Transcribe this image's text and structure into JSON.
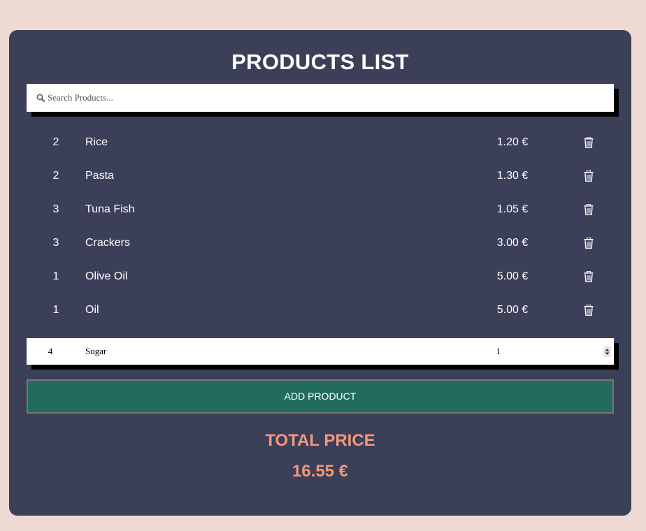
{
  "title": "PRODUCTS LIST",
  "search": {
    "placeholder": "Search Products...",
    "value": "",
    "icon": "search-icon"
  },
  "products": [
    {
      "qty": "2",
      "name": "Rice",
      "price": "1.20 €"
    },
    {
      "qty": "2",
      "name": "Pasta",
      "price": "1.30 €"
    },
    {
      "qty": "3",
      "name": "Tuna Fish",
      "price": "1.05 €"
    },
    {
      "qty": "3",
      "name": "Crackers",
      "price": "3.00 €"
    },
    {
      "qty": "1",
      "name": "Olive Oil",
      "price": "5.00 €"
    },
    {
      "qty": "1",
      "name": "Oil",
      "price": "5.00 €"
    }
  ],
  "add_form": {
    "qty_value": "4",
    "name_value": "Sugar",
    "price_value": "1",
    "button_label": "ADD PRODUCT"
  },
  "total": {
    "label": "TOTAL PRICE",
    "value": "16.55 €"
  },
  "colors": {
    "background": "#eed9d3",
    "card": "#3b3f58",
    "accent": "#f2977a",
    "button": "#236b5f"
  }
}
